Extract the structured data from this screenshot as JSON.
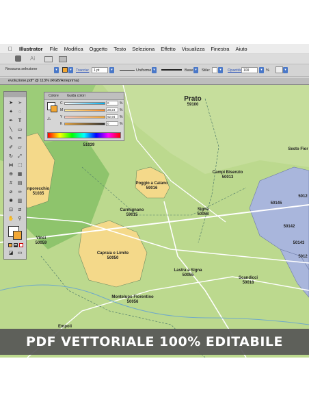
{
  "menubar": {
    "apple": "",
    "app_name": "Illustrator",
    "items": [
      "File",
      "Modifica",
      "Oggetto",
      "Testo",
      "Seleziona",
      "Effetto",
      "Visualizza",
      "Finestra",
      "Aiuto"
    ]
  },
  "control_bar": {
    "selection": "Nessuna selezione",
    "stroke_link": "Traccia:",
    "stroke_weight": "1 pt",
    "profile": "Uniforme",
    "brush": "Base",
    "style_label": "Stile:",
    "opacity_link": "Opacità:",
    "opacity_value": "100",
    "pct": "%"
  },
  "document_tab": "evoluzione.pdf* @ 113% (RGB/Anteprima)",
  "color_panel": {
    "tab_color": "Colore",
    "tab_guide": "Guida colori",
    "channels": [
      {
        "name": "C",
        "value": "0"
      },
      {
        "name": "M",
        "value": "28,24"
      },
      {
        "name": "Y",
        "value": "92,94"
      },
      {
        "name": "K",
        "value": "0"
      }
    ],
    "pct": "%"
  },
  "map_labels": [
    {
      "name": "Prato",
      "code": "59100",
      "big": true
    },
    {
      "name": "Campi Bisenzio",
      "code": "50013"
    },
    {
      "name": "Poggio a Caiano",
      "code": "59016"
    },
    {
      "name": "Carmignano",
      "code": "59015"
    },
    {
      "name": "Signa",
      "code": "50058"
    },
    {
      "name": "Carmignano",
      "code": "59015"
    },
    {
      "name": "Capraia e Limite",
      "code": "50050"
    },
    {
      "name": "Lastra a Signa",
      "code": "50055"
    },
    {
      "name": "Scandicci",
      "code": "50018"
    },
    {
      "name": "Montelupo Fiorentino",
      "code": "50056"
    },
    {
      "name": "Vinci",
      "code": "50059"
    },
    {
      "name": "Sesto Fior",
      "code": ""
    },
    {
      "name": "nporecchio",
      "code": "51035"
    },
    {
      "name": "",
      "code": "51039"
    },
    {
      "name": "Empoli",
      "code": ""
    }
  ],
  "map_codes": [
    "50145",
    "5012",
    "50142",
    "50143",
    "5012"
  ],
  "banner": "PDF VETTORIALE 100% EDITABILE",
  "colors": {
    "map_green": "#b8d68a",
    "yellow_area": "#f4d98a",
    "blue_area": "#a9b6dc",
    "road": "#ffffff",
    "banner_bg": "#565656"
  }
}
